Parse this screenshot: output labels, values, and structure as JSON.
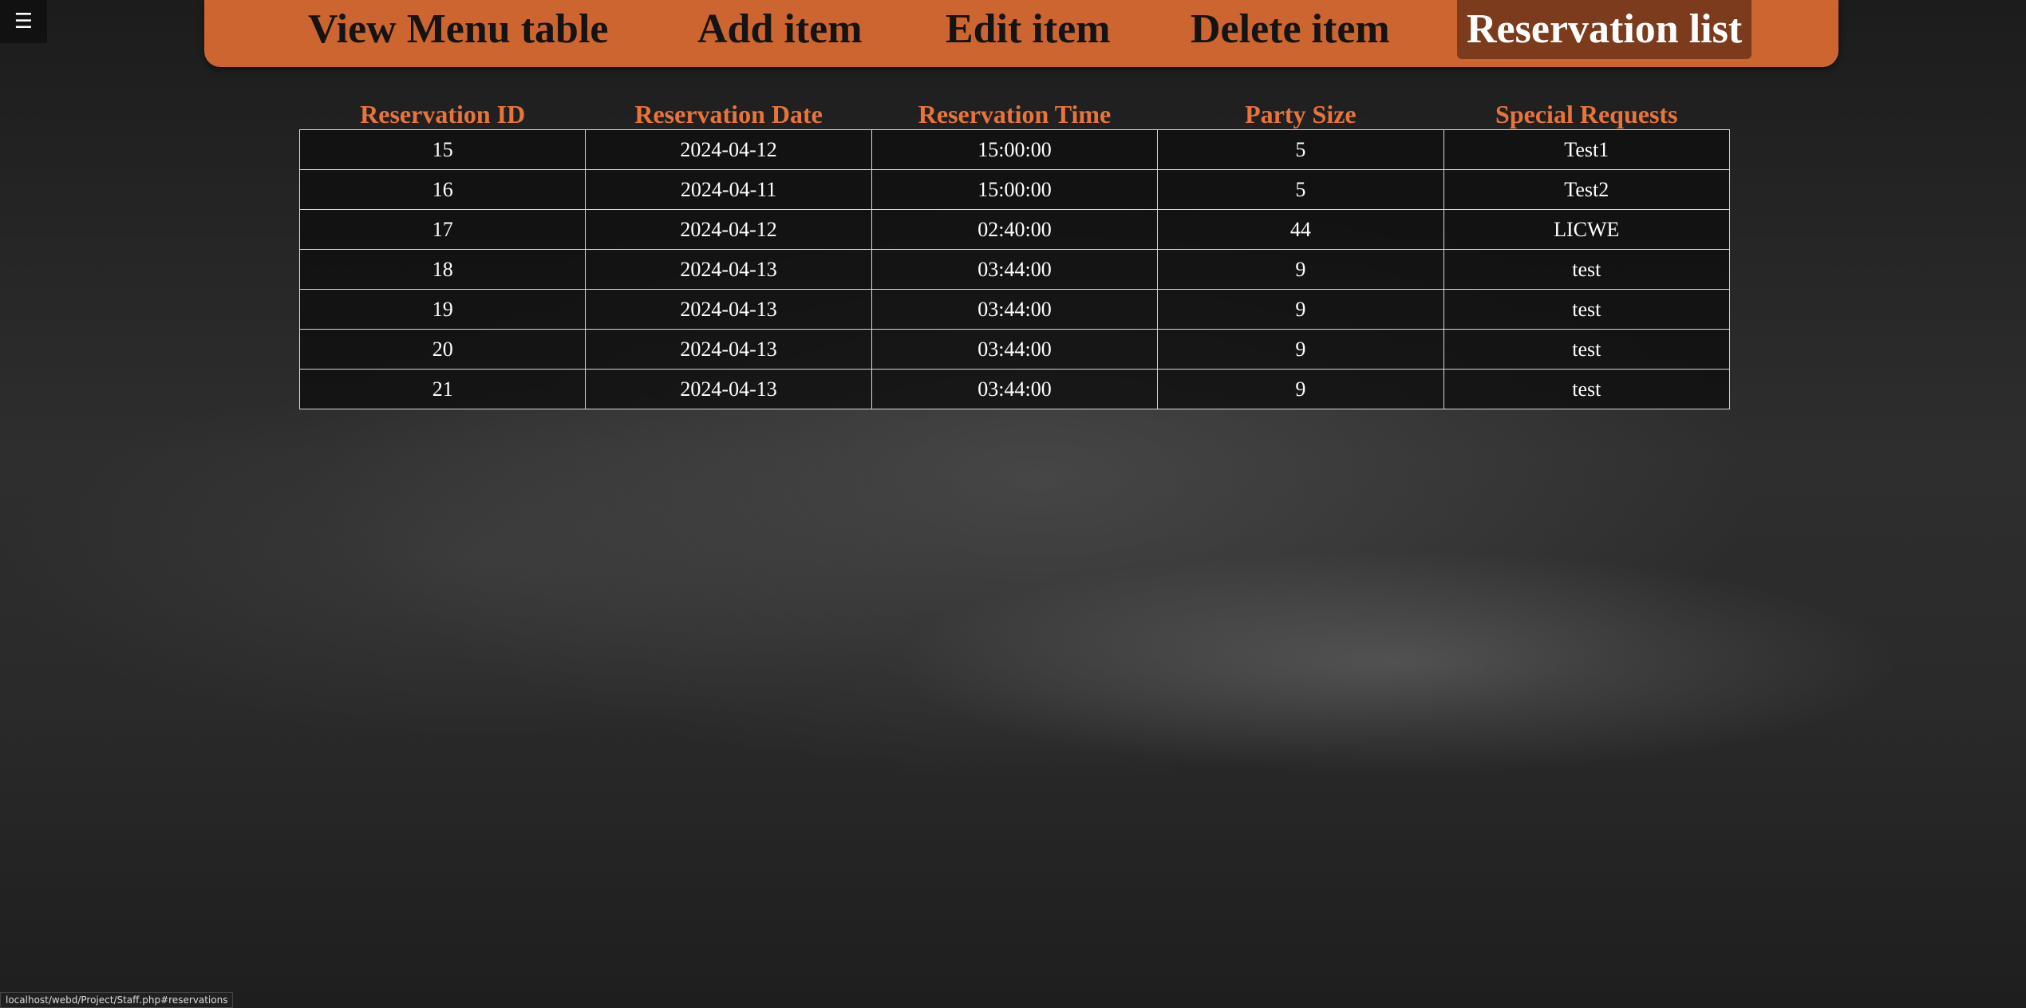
{
  "menu_icon": "☰",
  "nav": {
    "items": [
      {
        "label": "View Menu table"
      },
      {
        "label": "Add item"
      },
      {
        "label": "Edit item"
      },
      {
        "label": "Delete item"
      },
      {
        "label": "Reservation list"
      }
    ],
    "active_index": 4
  },
  "table": {
    "headers": [
      "Reservation ID",
      "Reservation Date",
      "Reservation Time",
      "Party Size",
      "Special Requests"
    ],
    "rows": [
      [
        "15",
        "2024-04-12",
        "15:00:00",
        "5",
        "Test1"
      ],
      [
        "16",
        "2024-04-11",
        "15:00:00",
        "5",
        "Test2"
      ],
      [
        "17",
        "2024-04-12",
        "02:40:00",
        "44",
        "LICWE"
      ],
      [
        "18",
        "2024-04-13",
        "03:44:00",
        "9",
        "test"
      ],
      [
        "19",
        "2024-04-13",
        "03:44:00",
        "9",
        "test"
      ],
      [
        "20",
        "2024-04-13",
        "03:44:00",
        "9",
        "test"
      ],
      [
        "21",
        "2024-04-13",
        "03:44:00",
        "9",
        "test"
      ]
    ]
  },
  "status_url": "localhost/webd/Project/Staff.php#reservations",
  "colors": {
    "navbar": "#cc6530",
    "active_tab": "#7c3b1c",
    "header_text": "#e8743b"
  }
}
